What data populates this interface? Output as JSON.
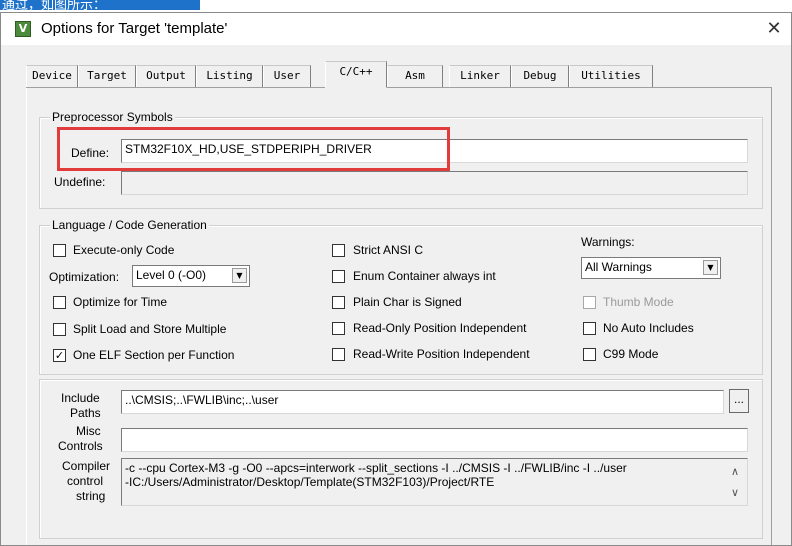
{
  "top_strip": {
    "text": "通过，如图所示："
  },
  "window": {
    "title": "Options for Target 'template'",
    "icon": "keil-uv-icon",
    "close_glyph": "✕"
  },
  "tabs": [
    {
      "label": "Device"
    },
    {
      "label": "Target"
    },
    {
      "label": "Output"
    },
    {
      "label": "Listing"
    },
    {
      "label": "User"
    },
    {
      "label": "C/C++",
      "active": true
    },
    {
      "label": "Asm"
    },
    {
      "label": "Linker"
    },
    {
      "label": "Debug"
    },
    {
      "label": "Utilities"
    }
  ],
  "preprocessor": {
    "title": "Preprocessor Symbols",
    "define_label": "Define:",
    "define_value": "STM32F10X_HD,USE_STDPERIPH_DRIVER",
    "undefine_label": "Undefine:",
    "undefine_value": ""
  },
  "language": {
    "title": "Language / Code Generation",
    "execute_only": {
      "label": "Execute-only Code",
      "checked": false
    },
    "optimization_label": "Optimization:",
    "optimization_value": "Level 0 (-O0)",
    "optimize_time": {
      "label": "Optimize for Time",
      "checked": false
    },
    "split_load": {
      "label": "Split Load and Store Multiple",
      "checked": false
    },
    "one_elf": {
      "label": "One ELF Section per Function",
      "checked": true
    },
    "strict_ansi": {
      "label": "Strict ANSI C",
      "checked": false
    },
    "enum_container": {
      "label": "Enum Container always int",
      "checked": false
    },
    "plain_char": {
      "label": "Plain Char is Signed",
      "checked": false
    },
    "ro_position": {
      "label": "Read-Only Position Independent",
      "checked": false
    },
    "rw_position": {
      "label": "Read-Write Position Independent",
      "checked": false
    },
    "warnings_label": "Warnings:",
    "warnings_value": "All Warnings",
    "thumb_mode": {
      "label": "Thumb Mode",
      "checked": false,
      "disabled": true
    },
    "no_auto_includes": {
      "label": "No Auto Includes",
      "checked": false
    },
    "c99_mode": {
      "label": "C99 Mode",
      "checked": false
    }
  },
  "include": {
    "include_label_1": "Include",
    "include_label_2": "Paths",
    "include_value": "..\\CMSIS;..\\FWLIB\\inc;..\\user",
    "browse_label": "...",
    "misc_label_1": "Misc",
    "misc_label_2": "Controls",
    "misc_value": "",
    "compiler_label_1": "Compiler",
    "compiler_label_2": "control",
    "compiler_label_3": "string",
    "compiler_line_1": "-c --cpu Cortex-M3 -g -O0 --apcs=interwork --split_sections -I ../CMSIS -I ../FWLIB/inc -I ../user",
    "compiler_line_2": "-IC:/Users/Administrator/Desktop/Template(STM32F103)/Project/RTE",
    "scroll_up": "∧",
    "scroll_down": "∨"
  }
}
